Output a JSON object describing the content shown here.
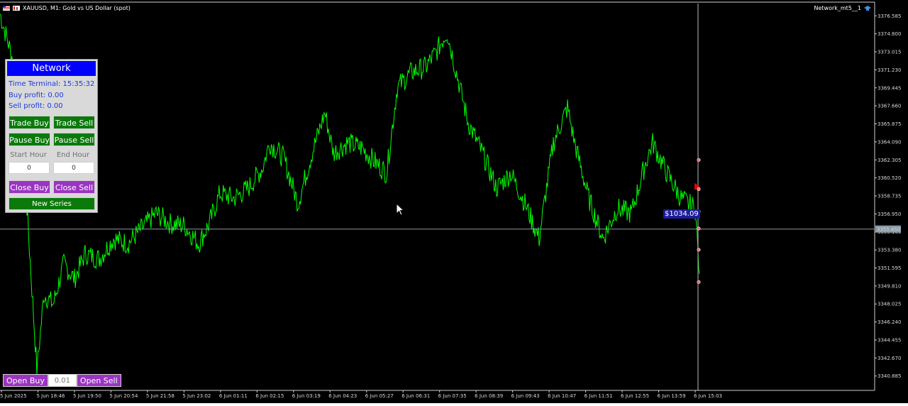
{
  "window": {
    "symbol_title": "XAUUSD, M1:  Gold vs US Dollar (spot)",
    "ea_title": "Network_mt5__1",
    "flag_icon": "flag-icon",
    "ea_icon": "graduation-hat-icon"
  },
  "panel": {
    "header": "Network",
    "time_terminal": "Time Terminal: 15:35:32",
    "buy_profit": "Buy profit: 0.00",
    "sell_profit": "Sell profit: 0.00",
    "trade_buy": "Trade Buy",
    "trade_sell": "Trade Sell",
    "pause_buy": "Pause Buy",
    "pause_sell": "Pause Sell",
    "start_hour_label": "Start Hour",
    "end_hour_label": "End Hour",
    "start_hour_value": "0",
    "end_hour_value": "0",
    "close_buy": "Close Buy",
    "close_sell": "Close Sell",
    "new_series": "New Series",
    "colors": {
      "header": "#0000ff",
      "green_button": "#0b7a0b",
      "purple_button": "#9b34c2",
      "info_text": "#1a3adf"
    }
  },
  "bottom_bar": {
    "open_buy": "Open Buy",
    "lot": "0.01",
    "open_sell": "Open Sell"
  },
  "profit_label": "$1034.09",
  "chart_data": {
    "type": "line",
    "title": "XAUUSD, M1:  Gold vs US Dollar (spot)",
    "series_color": "#00ff00",
    "price_axis_ticks": [
      "3376.585",
      "3374.800",
      "3373.015",
      "3371.230",
      "3369.445",
      "3367.660",
      "3365.875",
      "3364.090",
      "3362.305",
      "3360.520",
      "3358.735",
      "3356.950",
      "3355.165",
      "3353.380",
      "3351.595",
      "3349.810",
      "3348.025",
      "3346.240",
      "3344.455",
      "3342.670",
      "3340.885"
    ],
    "current_price_label": "3355.450",
    "time_axis_ticks": [
      "5 Jun 2025",
      "5 Jun 18:46",
      "5 Jun 19:50",
      "5 Jun 20:54",
      "5 Jun 21:58",
      "5 Jun 23:02",
      "6 Jun 01:11",
      "6 Jun 02:15",
      "6 Jun 03:19",
      "6 Jun 04:23",
      "6 Jun 05:27",
      "6 Jun 06:31",
      "6 Jun 07:35",
      "6 Jun 08:39",
      "6 Jun 09:43",
      "6 Jun 10:47",
      "6 Jun 11:51",
      "6 Jun 12:55",
      "6 Jun 13:59",
      "6 Jun 15:03"
    ],
    "ylim": [
      3339.6,
      3377.8
    ],
    "x": [
      0,
      18,
      38,
      52,
      62,
      75,
      90,
      105,
      120,
      140,
      160,
      180,
      200,
      220,
      240,
      260,
      280,
      295,
      310,
      330,
      350,
      370,
      380,
      400,
      420,
      440,
      458,
      470,
      490,
      510,
      530,
      545,
      560,
      580,
      600,
      615,
      630,
      640,
      660,
      680,
      700,
      720,
      740,
      760,
      780,
      800,
      810,
      830,
      850,
      870,
      890,
      910,
      920,
      940,
      960,
      980,
      986
    ],
    "y": [
      3376.8,
      3372.3,
      3357.5,
      3341.5,
      3349.0,
      3348.0,
      3352.0,
      3350.5,
      3353.0,
      3352.5,
      3354.5,
      3354.0,
      3355.5,
      3357.0,
      3356.0,
      3355.8,
      3354.0,
      3356.0,
      3359.0,
      3358.5,
      3359.5,
      3361.5,
      3364.0,
      3362.5,
      3358.0,
      3363.0,
      3367.0,
      3363.0,
      3364.0,
      3363.5,
      3362.0,
      3361.0,
      3369.5,
      3371.0,
      3371.5,
      3373.0,
      3375.0,
      3372.0,
      3366.0,
      3363.0,
      3359.5,
      3361.0,
      3358.0,
      3354.5,
      3364.0,
      3367.5,
      3364.0,
      3358.5,
      3354.5,
      3357.5,
      3357.0,
      3362.0,
      3364.0,
      3361.0,
      3358.5,
      3357.5,
      3351.0
    ],
    "current_price": 3355.45,
    "cursor_time_x": 984,
    "order_markers": [
      3362.3,
      3359.4,
      3357.2,
      3355.5,
      3353.4,
      3350.2
    ],
    "grid": false
  }
}
